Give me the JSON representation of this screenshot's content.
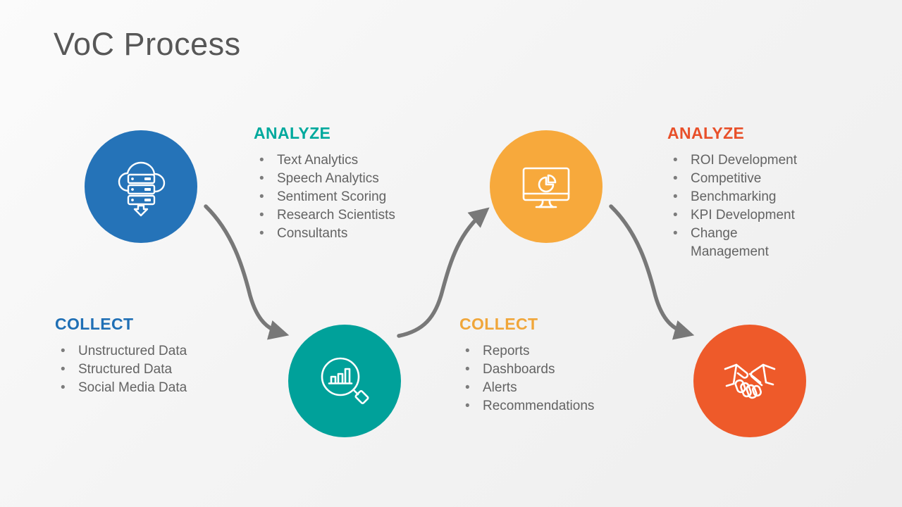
{
  "slide": {
    "title": "VoC Process",
    "background_color": "#F2F2F2",
    "title_color": "#575757"
  },
  "arrow_color": "#787878",
  "nodes": [
    {
      "id": "collect-source",
      "icon": "cloud-database-download-icon",
      "color": "#2573B8",
      "position": "top-left"
    },
    {
      "id": "analyze-search",
      "icon": "magnifier-bar-chart-icon",
      "color": "#00A19A",
      "position": "bottom-center-left"
    },
    {
      "id": "collect-report",
      "icon": "monitor-pie-chart-icon",
      "color": "#F7A93C",
      "position": "top-center-right"
    },
    {
      "id": "analyze-outcome",
      "icon": "handshake-icon",
      "color": "#EE5A2A",
      "position": "bottom-right"
    }
  ],
  "blocks": {
    "analyze_top": {
      "heading": "ANALYZE",
      "color": "#00A99D",
      "items": [
        "Text Analytics",
        "Speech Analytics",
        "Sentiment Scoring",
        "Research Scientists",
        "Consultants"
      ]
    },
    "analyze_right": {
      "heading": "ANALYZE",
      "color": "#E8502A",
      "items": [
        "ROI Development",
        "Competitive",
        "Benchmarking",
        "KPI Development",
        "Change\nManagement"
      ]
    },
    "collect_left": {
      "heading": "COLLECT",
      "color": "#1F6FB5",
      "items": [
        "Unstructured Data",
        "Structured Data",
        "Social Media Data"
      ]
    },
    "collect_mid": {
      "heading": "COLLECT",
      "color": "#F0A63A",
      "items": [
        "Reports",
        "Dashboards",
        "Alerts",
        "Recommendations"
      ]
    }
  }
}
